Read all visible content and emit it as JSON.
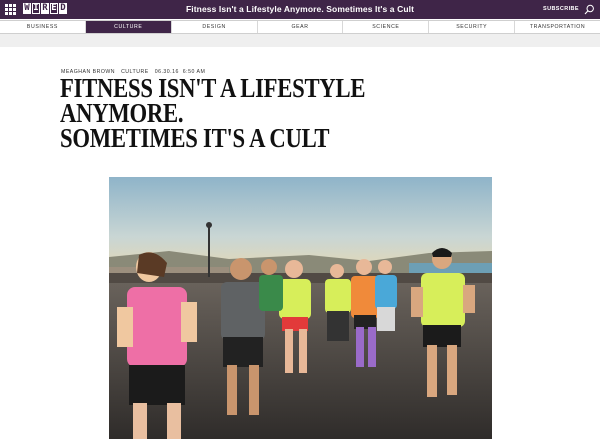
{
  "topbar": {
    "logo": "WIRED",
    "title": "Fitness Isn't a Lifestyle Anymore. Sometimes It's a Cult",
    "subscribe_label": "SUBSCRIBE",
    "menu_icon": "grid-menu-icon",
    "search_icon": "search-icon",
    "background": "#3f2548"
  },
  "nav": {
    "items": [
      {
        "label": "BUSINESS"
      },
      {
        "label": "CULTURE"
      },
      {
        "label": "DESIGN"
      },
      {
        "label": "GEAR"
      },
      {
        "label": "SCIENCE"
      },
      {
        "label": "SECURITY"
      },
      {
        "label": "TRANSPORTATION"
      }
    ],
    "active": "CULTURE"
  },
  "article": {
    "author": "MEAGHAN BROWN",
    "section": "CULTURE",
    "date": "06.30.16",
    "time": "6:50 AM",
    "headline_line1": "Fitness Isn't a Lifestyle Anymore.",
    "headline_line2": "Sometimes It's a Cult"
  }
}
